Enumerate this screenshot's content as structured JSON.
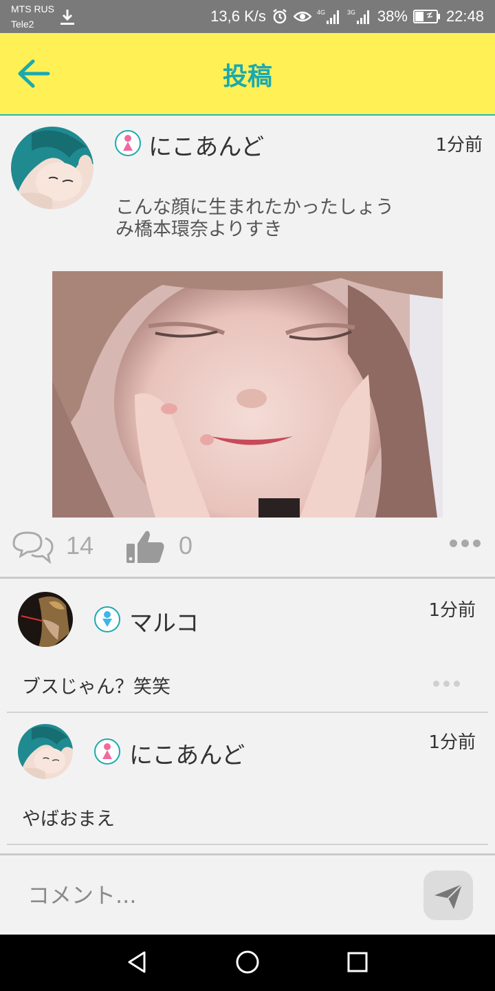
{
  "status_bar": {
    "carrier1": "MTS RUS",
    "carrier2": "Tele2",
    "speed": "13,6 K/s",
    "battery": "38%",
    "time": "22:48"
  },
  "header": {
    "title": "投稿"
  },
  "post": {
    "username": "にこあんど",
    "time": "1分前",
    "text_line1": "こんな顔に生まれたかったしょう",
    "text_line2": "み橋本環奈よりすき",
    "comment_count": "14",
    "like_count": "0"
  },
  "comments": [
    {
      "username": "マルコ",
      "time": "1分前",
      "text": "ブスじゃん？笑笑",
      "gender": "male"
    },
    {
      "username": "にこあんど",
      "time": "1分前",
      "text": "やばおまえ",
      "gender": "female"
    }
  ],
  "input": {
    "placeholder": "コメント..."
  },
  "colors": {
    "header_bg": "#fff056",
    "accent_teal": "#1aa9b0",
    "female_pink": "#f06aa0",
    "male_blue": "#3ab8e8"
  }
}
